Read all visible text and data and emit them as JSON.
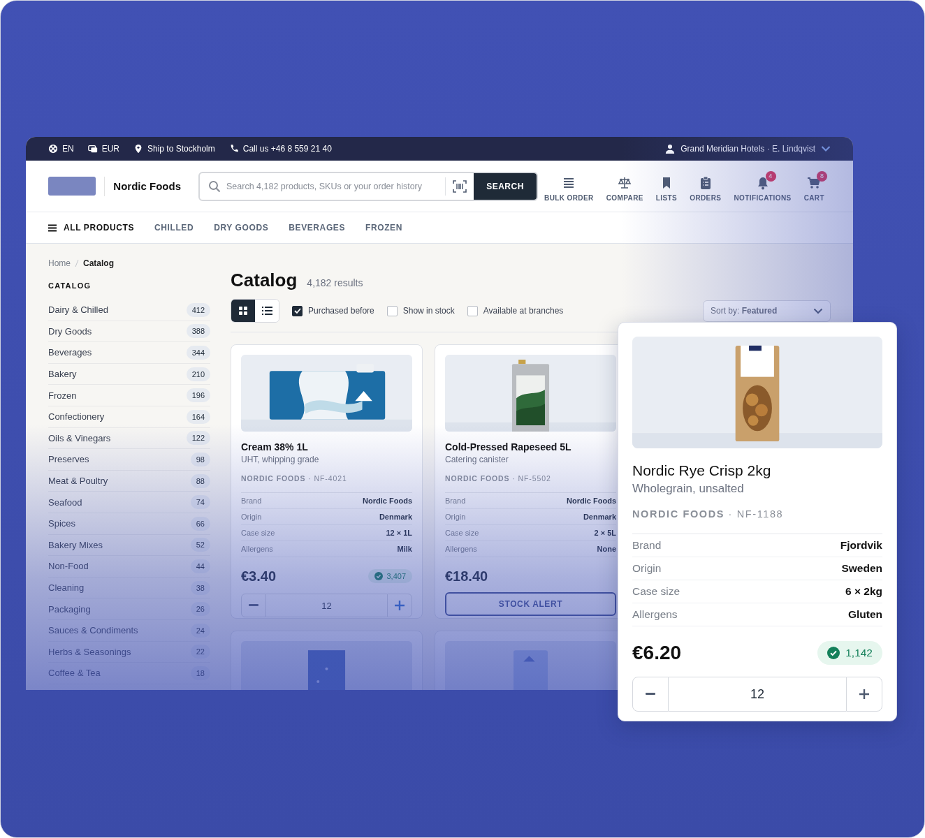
{
  "top_bar": {
    "items": [
      {
        "text": "EN"
      },
      {
        "text": "EUR"
      },
      {
        "text": "Ship to Stockholm"
      },
      {
        "text": "Call us +46 8 559 21 40"
      }
    ],
    "account": "Grand Meridian Hotels · E. Lindqvist"
  },
  "header": {
    "brand": "Nordic Foods",
    "search": {
      "placeholder": "Search 4,182 products, SKUs or your order history",
      "button": "SEARCH"
    },
    "actions": [
      {
        "label": "BULK ORDER"
      },
      {
        "label": "COMPARE"
      },
      {
        "label": "LISTS"
      },
      {
        "label": "ORDERS"
      },
      {
        "label": "NOTIFICATIONS",
        "badge": "4"
      },
      {
        "label": "CART",
        "badge": "8"
      }
    ]
  },
  "nav": [
    {
      "label": "ALL PRODUCTS",
      "selected": true
    },
    {
      "label": "CHILLED",
      "selected": false
    },
    {
      "label": "DRY GOODS",
      "selected": false
    },
    {
      "label": "BEVERAGES",
      "selected": false
    },
    {
      "label": "FROZEN",
      "selected": false
    }
  ],
  "breadcrumb": [
    "Home",
    "Catalog"
  ],
  "sidebar": {
    "title": "CATALOG",
    "items": [
      {
        "name": "Dairy & Chilled",
        "count": "412"
      },
      {
        "name": "Dry Goods",
        "count": "388"
      },
      {
        "name": "Beverages",
        "count": "344"
      },
      {
        "name": "Bakery",
        "count": "210"
      },
      {
        "name": "Frozen",
        "count": "196"
      },
      {
        "name": "Confectionery",
        "count": "164"
      },
      {
        "name": "Oils & Vinegars",
        "count": "122"
      },
      {
        "name": "Preserves",
        "count": "98"
      },
      {
        "name": "Meat & Poultry",
        "count": "88"
      },
      {
        "name": "Seafood",
        "count": "74"
      },
      {
        "name": "Spices",
        "count": "66"
      },
      {
        "name": "Bakery Mixes",
        "count": "52"
      },
      {
        "name": "Non-Food",
        "count": "44"
      },
      {
        "name": "Cleaning",
        "count": "38"
      },
      {
        "name": "Packaging",
        "count": "26"
      },
      {
        "name": "Sauces & Condiments",
        "count": "24"
      },
      {
        "name": "Herbs & Seasonings",
        "count": "22"
      },
      {
        "name": "Coffee & Tea",
        "count": "18"
      }
    ]
  },
  "catalog": {
    "title": "Catalog",
    "results": "4,182 results",
    "views": [
      {
        "kind": "grid",
        "selected": true
      },
      {
        "kind": "list",
        "selected": false
      }
    ],
    "filters": [
      {
        "label": "Purchased before",
        "checked": true
      },
      {
        "label": "Show in stock",
        "checked": false
      },
      {
        "label": "Available at branches",
        "checked": false
      }
    ],
    "sort": "Sort by: **Featured**"
  },
  "products": [
    {
      "image": {
        "kind": "picture"
      },
      "name": "Cream 38% 1L",
      "subtitle": "UHT, whipping grade",
      "brand_line": "**NORDIC FOODS** · NF-4021",
      "specs": [
        {
          "label": "Brand",
          "value": "Nordic Foods"
        },
        {
          "label": "Origin",
          "value": "Denmark"
        },
        {
          "label": "Case size",
          "value": "12 × 1L"
        },
        {
          "label": "Allergens",
          "value": "Milk"
        }
      ],
      "price": "€3.40",
      "stock": "3,407",
      "action": {
        "kind": "stepper",
        "quantity": "12"
      }
    },
    {
      "image": {
        "kind": "picture"
      },
      "name": "Cold-Pressed Rapeseed 5L",
      "subtitle": "Catering canister",
      "brand_line": "**NORDIC FOODS** · NF-5502",
      "specs": [
        {
          "label": "Brand",
          "value": "Nordic Foods"
        },
        {
          "label": "Origin",
          "value": "Denmark"
        },
        {
          "label": "Case size",
          "value": "2 × 5L"
        },
        {
          "label": "Allergens",
          "value": "None"
        }
      ],
      "price": "€18.40",
      "action": {
        "kind": "button",
        "label": "STOCK ALERT"
      }
    }
  ],
  "partial_cards": [
    {
      "kind": "picture"
    },
    {
      "kind": "picture"
    }
  ],
  "popover": {
    "image": {
      "kind": "picture"
    },
    "name": "Nordic Rye Crisp 2kg",
    "subtitle": "Wholegrain, unsalted",
    "brand_line": "**NORDIC FOODS** · NF-1188",
    "specs": [
      {
        "label": "Brand",
        "value": "Fjordvik"
      },
      {
        "label": "Origin",
        "value": "Sweden"
      },
      {
        "label": "Case size",
        "value": "6 × 2kg"
      },
      {
        "label": "Allergens",
        "value": "Gluten"
      }
    ],
    "price": "€6.20",
    "stock": "1,142",
    "action": {
      "kind": "stepper",
      "quantity": "12"
    }
  }
}
